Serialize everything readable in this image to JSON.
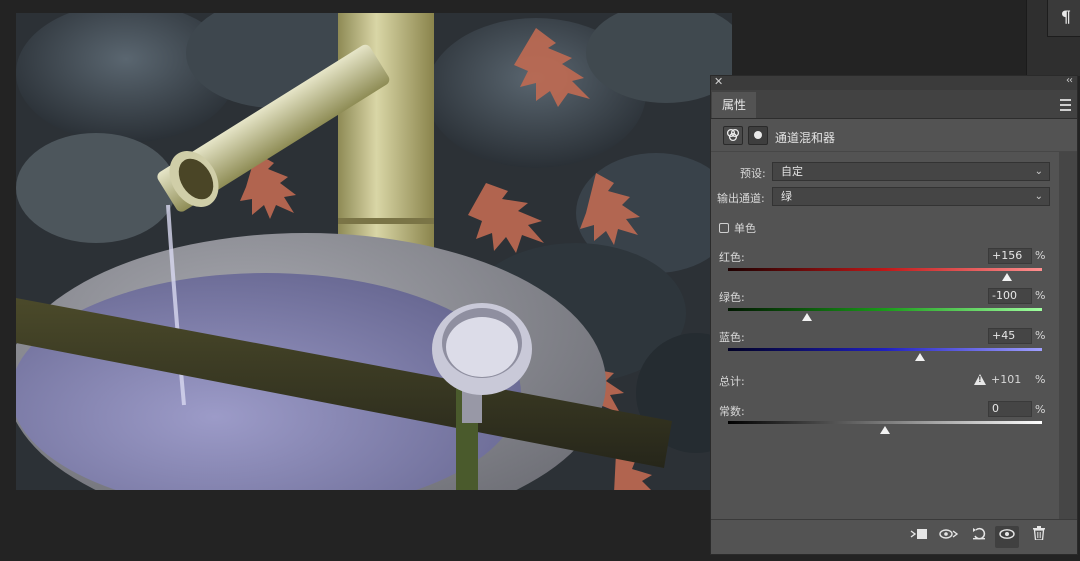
{
  "panel": {
    "tab_label": "属性",
    "title": "通道混和器",
    "preset": {
      "label": "预设:",
      "value": "自定"
    },
    "output_channel": {
      "label": "输出通道:",
      "value": "绿"
    },
    "monochrome": {
      "label": "单色",
      "checked": false
    },
    "sliders": [
      {
        "key": "red",
        "label": "红色:",
        "value": "+156",
        "unit": "%",
        "level": 156,
        "track_gradient": [
          "#1c0000",
          "#c01818",
          "#ff9090"
        ]
      },
      {
        "key": "green",
        "label": "绿色:",
        "value": "-100",
        "unit": "%",
        "level": -100,
        "track_gradient": [
          "#001600",
          "#1a9a1a",
          "#a0ffa0"
        ]
      },
      {
        "key": "blue",
        "label": "蓝色:",
        "value": "+45",
        "unit": "%",
        "level": 45,
        "track_gradient": [
          "#000024",
          "#2020c0",
          "#a0a0ff"
        ]
      }
    ],
    "total": {
      "label": "总计:",
      "value": "+101",
      "unit": "%"
    },
    "constant": {
      "label": "常数:",
      "value": "0",
      "unit": "%",
      "level": 0,
      "track_gradient": [
        "#000000",
        "#7a7a7a",
        "#ffffff"
      ]
    },
    "footer_icons": [
      "clip-to-layer-icon",
      "view-previous-state-icon",
      "reset-icon",
      "visibility-eye-icon",
      "trash-icon"
    ]
  },
  "toolbar": {
    "paragraph_icon": "¶"
  },
  "colors": {
    "panel_bg": "#535353",
    "app_bg": "#232323"
  }
}
